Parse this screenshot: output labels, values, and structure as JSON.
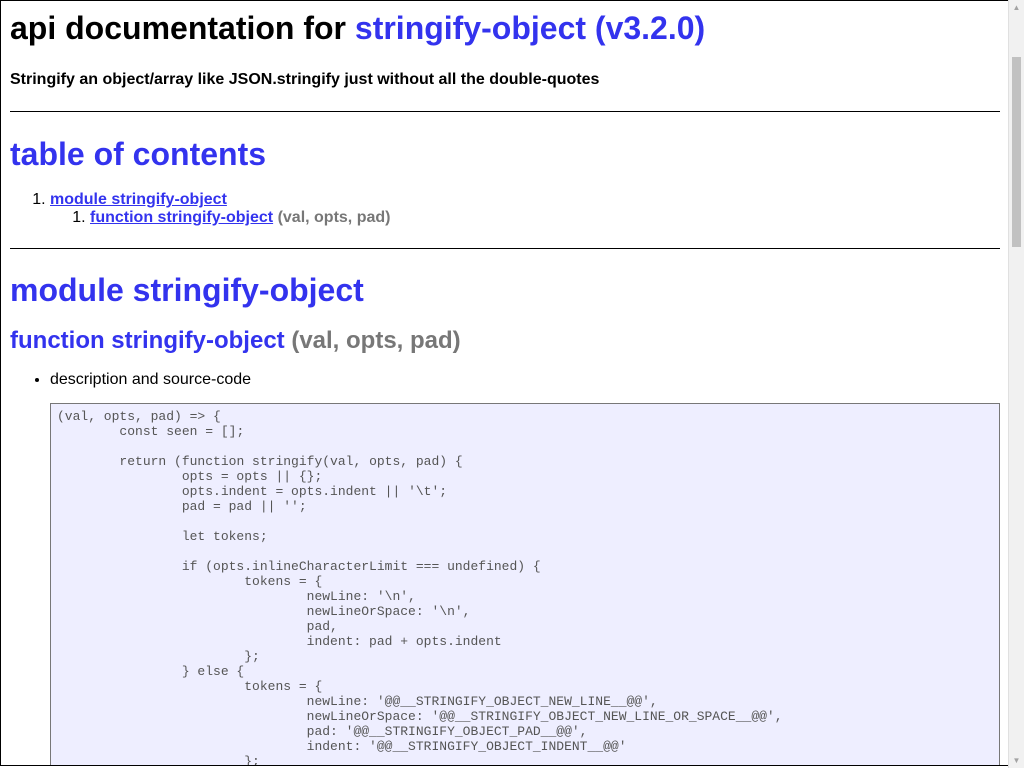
{
  "header": {
    "title_prefix": "api documentation for",
    "title_link": "stringify-object (v3.2.0)",
    "subtitle": "Stringify an object/array like JSON.stringify just without all the double-quotes"
  },
  "toc": {
    "title": "table of contents",
    "module_link": "module stringify-object",
    "function_link": "function stringify-object",
    "function_sig": "(val, opts, pad)"
  },
  "module": {
    "title": "module stringify-object",
    "function_name": "function stringify-object",
    "function_sig": "(val, opts, pad)",
    "desc_item": "description and source-code",
    "code": "(val, opts, pad) => {\n\tconst seen = [];\n\n\treturn (function stringify(val, opts, pad) {\n\t\topts = opts || {};\n\t\topts.indent = opts.indent || '\\t';\n\t\tpad = pad || '';\n\n\t\tlet tokens;\n\n\t\tif (opts.inlineCharacterLimit === undefined) {\n\t\t\ttokens = {\n\t\t\t\tnewLine: '\\n',\n\t\t\t\tnewLineOrSpace: '\\n',\n\t\t\t\tpad,\n\t\t\t\tindent: pad + opts.indent\n\t\t\t};\n\t\t} else {\n\t\t\ttokens = {\n\t\t\t\tnewLine: '@@__STRINGIFY_OBJECT_NEW_LINE__@@',\n\t\t\t\tnewLineOrSpace: '@@__STRINGIFY_OBJECT_NEW_LINE_OR_SPACE__@@',\n\t\t\t\tpad: '@@__STRINGIFY_OBJECT_PAD__@@',\n\t\t\t\tindent: '@@__STRINGIFY_OBJECT_INDENT__@@'\n\t\t\t};"
  },
  "colors": {
    "link": "#3333ee",
    "signature": "#777777",
    "code_bg": "#eeeeff"
  }
}
